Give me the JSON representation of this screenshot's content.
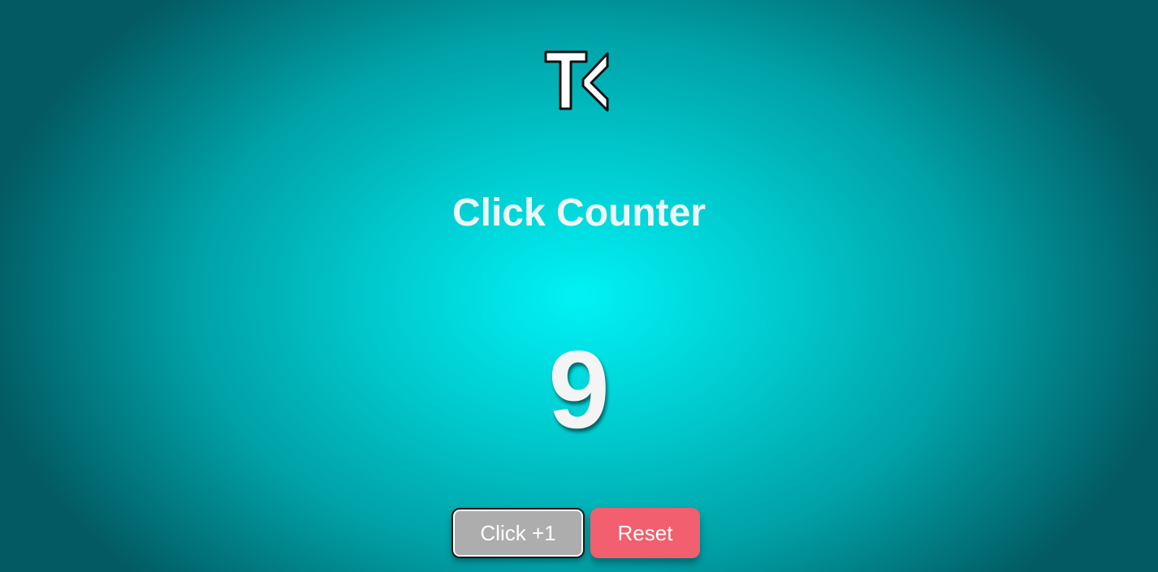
{
  "app": {
    "title": "Click Counter",
    "counter_value": "9"
  },
  "buttons": {
    "click_label": "Click +1",
    "reset_label": "Reset"
  },
  "icons": {
    "logo": "tk-logo-icon"
  },
  "colors": {
    "background_center": "#00f2f5",
    "background_edge": "#035a62",
    "click_button": "#adadad",
    "reset_button": "#f25f6e",
    "text": "#f4f4f4"
  }
}
